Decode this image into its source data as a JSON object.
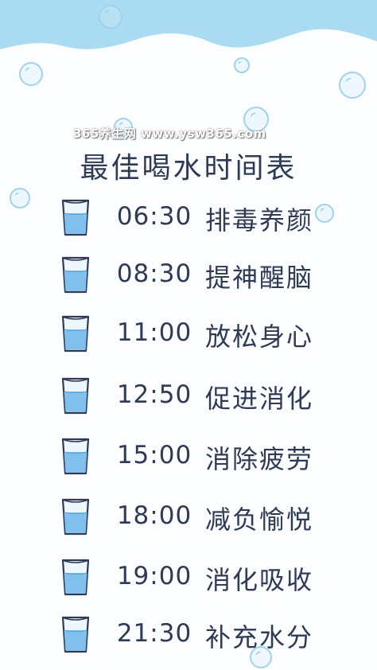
{
  "watermark": "365养生网 www.ysw365.com",
  "title": "最佳喝水时间表",
  "schedule": [
    {
      "time": "06:30",
      "label": "排毒养颜"
    },
    {
      "time": "08:30",
      "label": "提神醒脑"
    },
    {
      "time": "11:00",
      "label": "放松身心"
    },
    {
      "time": "12:50",
      "label": "促进消化"
    },
    {
      "time": "15:00",
      "label": "消除疲劳"
    },
    {
      "time": "18:00",
      "label": "减负愉悦"
    },
    {
      "time": "19:00",
      "label": "消化吸收"
    },
    {
      "time": "21:30",
      "label": "补充水分"
    }
  ],
  "colors": {
    "wave": "#a9dbf2",
    "water": "#7fc0ec",
    "text": "#2e3a56",
    "bubble": "#9fd3ec"
  }
}
